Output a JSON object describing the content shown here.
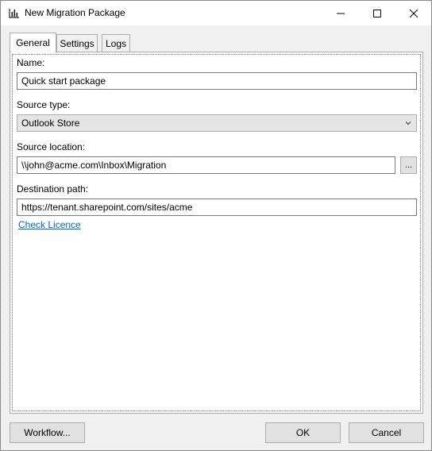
{
  "window": {
    "title": "New Migration Package",
    "app_icon": "bar-chart-icon"
  },
  "titlebar_controls": {
    "minimize": "minimize-icon",
    "maximize": "maximize-icon",
    "close": "close-icon"
  },
  "tabs": [
    {
      "label": "General",
      "active": true
    },
    {
      "label": "Settings",
      "active": false
    },
    {
      "label": "Logs",
      "active": false
    }
  ],
  "general": {
    "name_label": "Name:",
    "name_value": "Quick start package",
    "source_type_label": "Source type:",
    "source_type_value": "Outlook Store",
    "source_location_label": "Source location:",
    "source_location_value": "\\\\john@acme.com\\Inbox\\Migration",
    "browse_label": "...",
    "destination_label": "Destination path:",
    "destination_value": "https://tenant.sharepoint.com/sites/acme",
    "check_licence_link": "Check Licence"
  },
  "footer": {
    "workflow_label": "Workflow...",
    "ok_label": "OK",
    "cancel_label": "Cancel"
  },
  "colors": {
    "link": "#0066cc",
    "window_bg": "#f0f0f0",
    "panel_bg": "#ffffff"
  }
}
